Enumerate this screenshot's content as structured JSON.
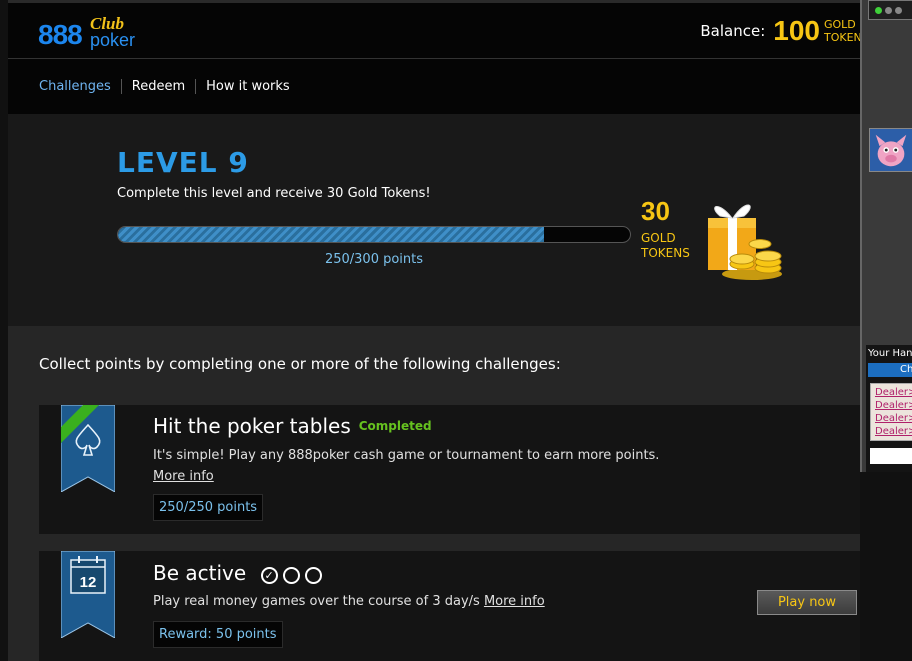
{
  "logo": {
    "brand": "888",
    "club": "Club",
    "poker": "poker"
  },
  "balance": {
    "label": "Balance:",
    "amount": "100",
    "unit": "GOLD TOKENS"
  },
  "nav": {
    "items": [
      {
        "label": "Challenges",
        "active": true
      },
      {
        "label": "Redeem",
        "active": false
      },
      {
        "label": "How it works",
        "active": false
      }
    ]
  },
  "level": {
    "title": "LEVEL 9",
    "description": "Complete this level and receive 30 Gold Tokens!",
    "progress_text": "250/300 points",
    "progress_fraction": 0.833,
    "reward_amount": "30",
    "reward_unit": "GOLD TOKENS"
  },
  "collect_text": "Collect points by completing one or more of the following challenges:",
  "challenges": [
    {
      "title": "Hit the poker tables",
      "status": "Completed",
      "description": "It's simple! Play any 888poker cash game or tournament to earn more points.",
      "more_info": "More info",
      "points": "250/250 points"
    },
    {
      "title": "Be active",
      "description": "Play real money games over the course of 3 day/s",
      "more_info": "More info",
      "reward": "Reward: 50 points",
      "button": "Play now",
      "calendar_day": "12"
    }
  ],
  "side_panel": {
    "hand_label": "Your Hand",
    "chat_tab": "Ch",
    "log": [
      "Dealer>",
      "Dealer>",
      "Dealer>",
      "Dealer>"
    ]
  },
  "colors": {
    "accent_blue": "#2c9be6",
    "gold": "#f7c614",
    "completed_green": "#66c21f"
  }
}
